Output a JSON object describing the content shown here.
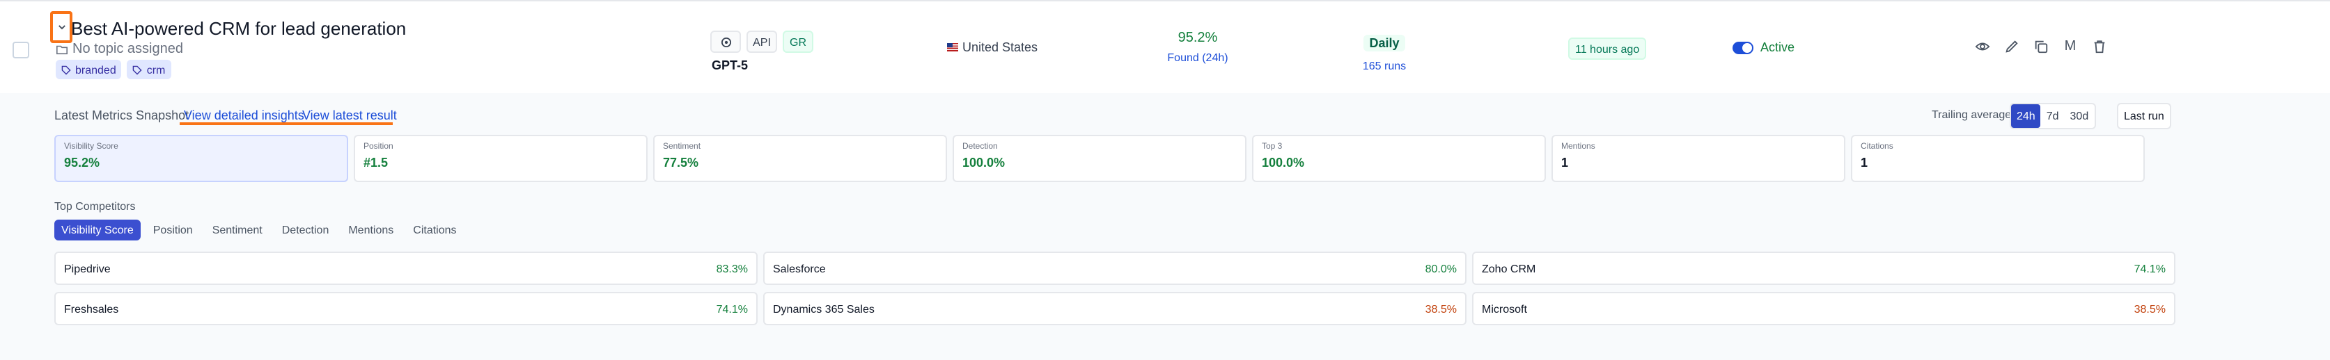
{
  "row": {
    "title": "Best AI-powered CRM for lead generation",
    "topic": "No topic assigned",
    "tags": [
      "branded",
      "crm"
    ],
    "model_badges": [
      "API",
      "GR"
    ],
    "model": "GPT-5",
    "country": "United States",
    "visibility": "95.2%",
    "found": "Found (24h)",
    "frequency": "Daily",
    "runs": "165 runs",
    "last_run_ago": "11 hours ago",
    "status": "Active",
    "action_m": "M"
  },
  "panel": {
    "snapshot_label": "Latest Metrics Snapshot",
    "link_insights": "View detailed insights",
    "link_latest": "View latest result",
    "trailing_label": "Trailing average",
    "ranges": [
      "24h",
      "7d",
      "30d"
    ],
    "selected_range": "24h",
    "last_run_button": "Last run",
    "metrics": [
      {
        "label": "Visibility Score",
        "value": "95.2%"
      },
      {
        "label": "Position",
        "value": "#1.5"
      },
      {
        "label": "Sentiment",
        "value": "77.5%"
      },
      {
        "label": "Detection",
        "value": "100.0%"
      },
      {
        "label": "Top 3",
        "value": "100.0%"
      },
      {
        "label": "Mentions",
        "value": "1"
      },
      {
        "label": "Citations",
        "value": "1"
      }
    ],
    "competitors_label": "Top Competitors",
    "competitor_tabs": [
      "Visibility Score",
      "Position",
      "Sentiment",
      "Detection",
      "Mentions",
      "Citations"
    ],
    "competitors": [
      {
        "name": "Pipedrive",
        "value": "83.3%"
      },
      {
        "name": "Salesforce",
        "value": "80.0%"
      },
      {
        "name": "Zoho CRM",
        "value": "74.1%"
      },
      {
        "name": "Freshsales",
        "value": "74.1%"
      },
      {
        "name": "Dynamics 365 Sales",
        "value": "38.5%"
      },
      {
        "name": "Microsoft",
        "value": "38.5%"
      }
    ]
  },
  "colors": {
    "accent": "#2f49c5",
    "highlight": "#f97316",
    "good": "#15803d",
    "warn": "#c2410c",
    "link": "#1d4ed8"
  }
}
